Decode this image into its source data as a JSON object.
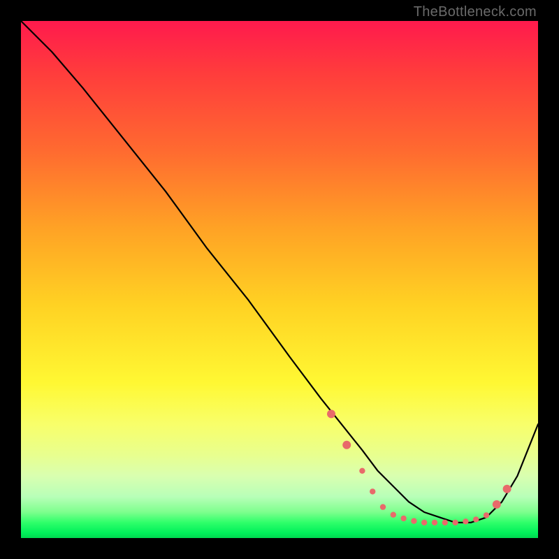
{
  "watermark": "TheBottleneck.com",
  "chart_data": {
    "type": "line",
    "title": "",
    "xlabel": "",
    "ylabel": "",
    "xlim": [
      0,
      100
    ],
    "ylim": [
      0,
      100
    ],
    "series": [
      {
        "name": "curve",
        "x": [
          0,
          6,
          12,
          20,
          28,
          36,
          44,
          52,
          58,
          62,
          66,
          69,
          72,
          75,
          78,
          81,
          84,
          87,
          90,
          93,
          96,
          100
        ],
        "y": [
          100,
          94,
          87,
          77,
          67,
          56,
          46,
          35,
          27,
          22,
          17,
          13,
          10,
          7,
          5,
          4,
          3,
          3,
          4,
          7,
          12,
          22
        ]
      }
    ],
    "markers": {
      "name": "highlight-dots",
      "color": "#e86a6a",
      "points": [
        {
          "x": 60,
          "y": 24
        },
        {
          "x": 63,
          "y": 18
        },
        {
          "x": 66,
          "y": 13
        },
        {
          "x": 68,
          "y": 9
        },
        {
          "x": 70,
          "y": 6
        },
        {
          "x": 72,
          "y": 4.5
        },
        {
          "x": 74,
          "y": 3.8
        },
        {
          "x": 76,
          "y": 3.3
        },
        {
          "x": 78,
          "y": 3.0
        },
        {
          "x": 80,
          "y": 3.0
        },
        {
          "x": 82,
          "y": 3.0
        },
        {
          "x": 84,
          "y": 3.0
        },
        {
          "x": 86,
          "y": 3.2
        },
        {
          "x": 88,
          "y": 3.6
        },
        {
          "x": 90,
          "y": 4.4
        },
        {
          "x": 92,
          "y": 6.5
        },
        {
          "x": 94,
          "y": 9.5
        }
      ]
    }
  }
}
